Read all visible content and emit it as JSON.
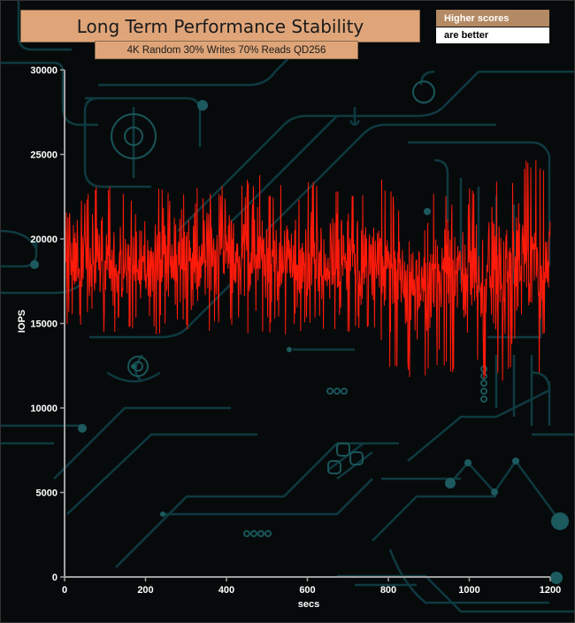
{
  "legend": {
    "line1": "Higher scores",
    "line2": "are better"
  },
  "chart_data": {
    "type": "line",
    "title": "Long Term Performance Stability",
    "subtitle": "4K Random 30% Writes 70% Reads QD256",
    "xlabel": "secs",
    "ylabel": "IOPS",
    "xlim": [
      0,
      1200
    ],
    "ylim": [
      0,
      30000
    ],
    "xticks": [
      0,
      200,
      400,
      600,
      800,
      1000,
      1200
    ],
    "yticks": [
      0,
      5000,
      10000,
      15000,
      20000,
      25000,
      30000
    ],
    "grid": false,
    "series": [
      {
        "color": "#ff1a0a",
        "x": [
          0,
          25,
          50,
          75,
          100,
          125,
          150,
          175,
          200,
          225,
          250,
          275,
          300,
          325,
          350,
          375,
          400,
          425,
          450,
          475,
          500,
          525,
          550,
          575,
          600,
          625,
          650,
          675,
          700,
          725,
          750,
          775,
          800,
          825,
          850,
          875,
          900,
          925,
          950,
          975,
          1000,
          1025,
          1050,
          1075,
          1100,
          1125,
          1150,
          1175,
          1200
        ],
        "y_mean": [
          18800,
          18500,
          18700,
          18600,
          18400,
          18700,
          18500,
          18600,
          18700,
          18500,
          18600,
          18700,
          18600,
          18800,
          18700,
          18600,
          18700,
          18600,
          18700,
          18800,
          18700,
          18600,
          18700,
          18600,
          18700,
          18600,
          18500,
          18600,
          18600,
          18700,
          18600,
          18500,
          17800,
          17600,
          17700,
          17500,
          17800,
          17600,
          17700,
          17500,
          17600,
          17800,
          17600,
          17700,
          17800,
          17900,
          18100,
          17900,
          17800
        ],
        "y_max": [
          23800,
          23500,
          23200,
          23400,
          23000,
          23400,
          23300,
          23500,
          23100,
          23400,
          23300,
          23600,
          23500,
          23700,
          23400,
          23300,
          23500,
          23200,
          23600,
          24200,
          23700,
          23500,
          23600,
          23400,
          23600,
          23500,
          23200,
          23400,
          23200,
          23500,
          23600,
          23500,
          23800,
          22400,
          22600,
          23200,
          22800,
          22600,
          23000,
          22800,
          23200,
          23400,
          23600,
          23300,
          23900,
          24500,
          25300,
          24800,
          23800
        ],
        "y_min": [
          14900,
          14600,
          14300,
          14100,
          14500,
          14200,
          14400,
          14200,
          14500,
          14300,
          14600,
          14300,
          14500,
          14200,
          14400,
          14300,
          14500,
          14200,
          14400,
          14300,
          14300,
          14500,
          14200,
          14400,
          14300,
          14500,
          14400,
          14300,
          14500,
          14500,
          14200,
          14300,
          12000,
          11500,
          11600,
          11000,
          12000,
          11800,
          11500,
          11200,
          12500,
          12000,
          11400,
          10800,
          11500,
          12200,
          12400,
          11800,
          14600
        ]
      }
    ]
  }
}
